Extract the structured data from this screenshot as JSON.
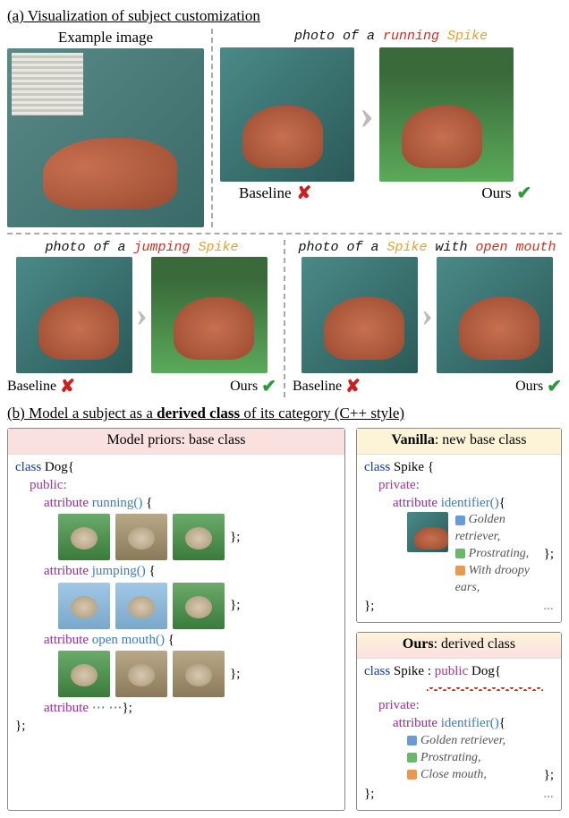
{
  "section_a": "(a) Visualization of subject customization",
  "example_label": "Example image",
  "prompts": {
    "running": {
      "prefix": "photo of a ",
      "attr": "running ",
      "subj": "Spike"
    },
    "jumping": {
      "prefix": "photo of a ",
      "attr": "jumping ",
      "subj": "Spike"
    },
    "openmouth": {
      "prefix": "photo of a ",
      "subj": "Spike",
      "mid": " with ",
      "attr": "open mouth"
    }
  },
  "labels": {
    "baseline": "Baseline",
    "ours": "Ours",
    "cross": "✘",
    "check": "✔"
  },
  "section_b": "(b) Model a subject as a ",
  "section_b_bold": "derived class",
  "section_b_tail": " of its category (C++ style)",
  "boxes": {
    "priors": {
      "title": "Model priors: base class",
      "class_kw": "class ",
      "class_name": "Dog",
      "open": "{",
      "public": "public:",
      "attr_kw": "attribute ",
      "fns": [
        "running()",
        "jumping()",
        "open mouth()"
      ],
      "ellipsis": "⋯ ⋯",
      "brace_open": "  {",
      "brace_close": "};"
    },
    "vanilla": {
      "title_b": "Vanilla",
      "title_tail": ": new base class",
      "class_kw": "class ",
      "class_name": "Spike ",
      "open": "{",
      "private": "private:",
      "attr_kw": "attribute ",
      "fn": "identifier()",
      "br": "{",
      "items": [
        "Golden retriever,",
        "Prostrating,",
        "With droopy ears,"
      ],
      "ell": "...",
      "close": "};"
    },
    "ours": {
      "title_b": "Ours",
      "title_tail": ": derived class",
      "class_kw": "class ",
      "class_name": "Spike ",
      "inherit": ": ",
      "pub": "public ",
      "base": "Dog",
      "open": "{",
      "private": "private:",
      "attr_kw": "attribute ",
      "fn": "identifier()",
      "br": "{",
      "items": [
        "Golden retriever,",
        "Prostrating,",
        "Close mouth,"
      ],
      "ell": "...",
      "close": "};"
    }
  }
}
